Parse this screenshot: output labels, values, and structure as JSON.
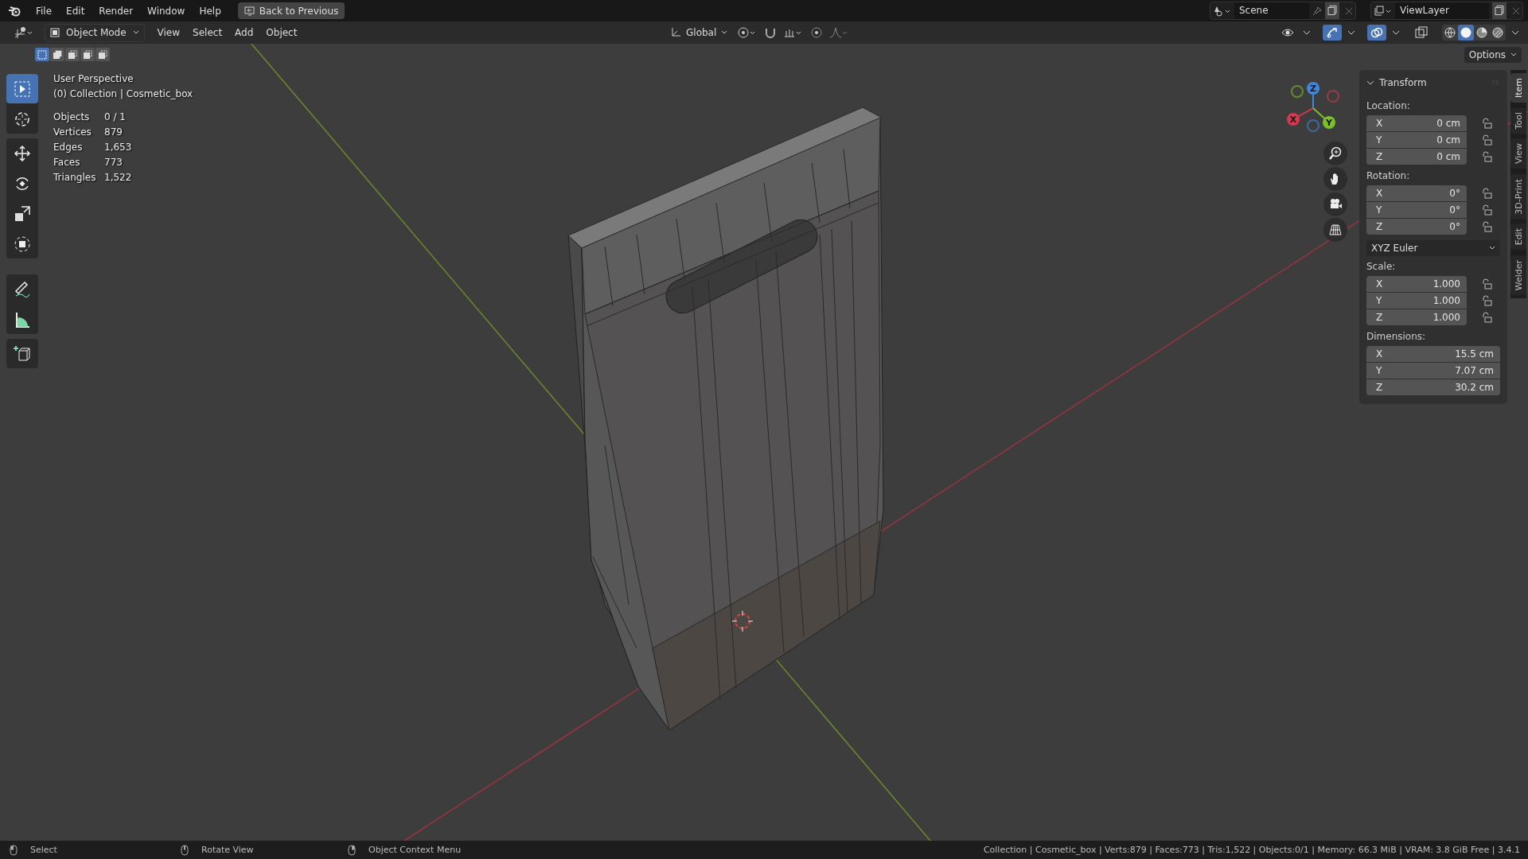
{
  "menu_bar": {
    "menus": [
      "File",
      "Edit",
      "Render",
      "Window",
      "Help"
    ],
    "back_button": "Back to Previous",
    "scene": "Scene",
    "view_layer": "ViewLayer"
  },
  "header": {
    "mode": "Object Mode",
    "menus": [
      "View",
      "Select",
      "Add",
      "Object"
    ],
    "orientation": "Global",
    "select_modes": [
      {
        "selected": true
      },
      {
        "selected": false
      },
      {
        "selected": false
      },
      {
        "selected": false
      },
      {
        "selected": false
      }
    ],
    "toggles": [
      {
        "kind": "visibility",
        "on": false
      },
      {
        "kind": "gizmos",
        "on": true
      },
      {
        "kind": "overlays",
        "on": true
      },
      {
        "kind": "xray",
        "on": false
      }
    ],
    "shading": [
      {
        "kind": "wireframe",
        "selected": false
      },
      {
        "kind": "solid",
        "selected": true
      },
      {
        "kind": "material",
        "selected": false
      },
      {
        "kind": "rendered",
        "selected": false
      }
    ],
    "options": "Options"
  },
  "toolbar": [
    {
      "tools": [
        {
          "kind": "select",
          "selected": true
        },
        {
          "kind": "cursor",
          "selected": false
        }
      ]
    },
    {
      "tools": [
        {
          "kind": "move",
          "selected": false
        },
        {
          "kind": "rotate",
          "selected": false
        },
        {
          "kind": "scale",
          "selected": false
        },
        {
          "kind": "transform",
          "selected": false
        }
      ]
    },
    {
      "tools": [
        {
          "kind": "annotate",
          "selected": false
        },
        {
          "kind": "measure",
          "selected": false
        }
      ]
    },
    {
      "tools": [
        {
          "kind": "add_cube",
          "selected": false
        }
      ]
    }
  ],
  "viewport_info": {
    "view": "User Perspective",
    "object": "(0) Collection | Cosmetic_box",
    "stats": [
      {
        "label": "Objects",
        "value": "0 / 1"
      },
      {
        "label": "Vertices",
        "value": "879"
      },
      {
        "label": "Edges",
        "value": "1,653"
      },
      {
        "label": "Faces",
        "value": "773"
      },
      {
        "label": "Triangles",
        "value": "1,522"
      }
    ]
  },
  "gizmo": [
    {
      "label": "X",
      "color": "#d8384f"
    },
    {
      "label": "Y",
      "color": "#7bbf2b"
    },
    {
      "label": "Z",
      "color": "#3f86dd"
    }
  ],
  "sidebar": {
    "panel": {
      "title": "Transform",
      "expanded": true,
      "groups": [
        {
          "label": "Location:",
          "fields": [
            {
              "axis": "X",
              "value": "0 cm",
              "locked": false
            },
            {
              "axis": "Y",
              "value": "0 cm",
              "locked": false
            },
            {
              "axis": "Z",
              "value": "0 cm",
              "locked": false
            }
          ]
        },
        {
          "label": "Rotation:",
          "fields": [
            {
              "axis": "X",
              "value": "0°",
              "locked": false
            },
            {
              "axis": "Y",
              "value": "0°",
              "locked": false
            },
            {
              "axis": "Z",
              "value": "0°",
              "locked": false
            }
          ],
          "dropdown": "XYZ Euler"
        },
        {
          "label": "Scale:",
          "fields": [
            {
              "axis": "X",
              "value": "1.000",
              "locked": false
            },
            {
              "axis": "Y",
              "value": "1.000",
              "locked": false
            },
            {
              "axis": "Z",
              "value": "1.000",
              "locked": false
            }
          ]
        },
        {
          "label": "Dimensions:",
          "fields": [
            {
              "axis": "X",
              "value": "15.5 cm"
            },
            {
              "axis": "Y",
              "value": "7.07 cm"
            },
            {
              "axis": "Z",
              "value": "30.2 cm"
            }
          ]
        }
      ]
    },
    "tabs": [
      {
        "label": "Item",
        "selected": true
      },
      {
        "label": "Tool",
        "selected": false
      },
      {
        "label": "View",
        "selected": false
      },
      {
        "label": "3D-Print",
        "selected": false
      },
      {
        "label": "Edit",
        "selected": false
      },
      {
        "label": "Welder",
        "selected": false
      }
    ]
  },
  "status_bar": {
    "hints": [
      "Select",
      "Rotate View",
      "Object Context Menu"
    ],
    "info": "Collection | Cosmetic_box | Verts:879 | Faces:773 | Tris:1,522 | Objects:0/1 | Memory: 66.3 MiB | VRAM: 3.8 GiB Free | 3.4.1"
  }
}
